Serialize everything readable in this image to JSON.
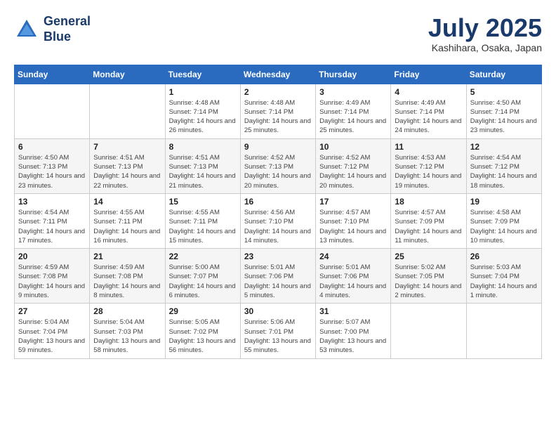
{
  "logo": {
    "line1": "General",
    "line2": "Blue"
  },
  "title": "July 2025",
  "location": "Kashihara, Osaka, Japan",
  "weekdays": [
    "Sunday",
    "Monday",
    "Tuesday",
    "Wednesday",
    "Thursday",
    "Friday",
    "Saturday"
  ],
  "weeks": [
    [
      {
        "day": "",
        "info": ""
      },
      {
        "day": "",
        "info": ""
      },
      {
        "day": "1",
        "info": "Sunrise: 4:48 AM\nSunset: 7:14 PM\nDaylight: 14 hours and 26 minutes."
      },
      {
        "day": "2",
        "info": "Sunrise: 4:48 AM\nSunset: 7:14 PM\nDaylight: 14 hours and 25 minutes."
      },
      {
        "day": "3",
        "info": "Sunrise: 4:49 AM\nSunset: 7:14 PM\nDaylight: 14 hours and 25 minutes."
      },
      {
        "day": "4",
        "info": "Sunrise: 4:49 AM\nSunset: 7:14 PM\nDaylight: 14 hours and 24 minutes."
      },
      {
        "day": "5",
        "info": "Sunrise: 4:50 AM\nSunset: 7:14 PM\nDaylight: 14 hours and 23 minutes."
      }
    ],
    [
      {
        "day": "6",
        "info": "Sunrise: 4:50 AM\nSunset: 7:13 PM\nDaylight: 14 hours and 23 minutes."
      },
      {
        "day": "7",
        "info": "Sunrise: 4:51 AM\nSunset: 7:13 PM\nDaylight: 14 hours and 22 minutes."
      },
      {
        "day": "8",
        "info": "Sunrise: 4:51 AM\nSunset: 7:13 PM\nDaylight: 14 hours and 21 minutes."
      },
      {
        "day": "9",
        "info": "Sunrise: 4:52 AM\nSunset: 7:13 PM\nDaylight: 14 hours and 20 minutes."
      },
      {
        "day": "10",
        "info": "Sunrise: 4:52 AM\nSunset: 7:12 PM\nDaylight: 14 hours and 20 minutes."
      },
      {
        "day": "11",
        "info": "Sunrise: 4:53 AM\nSunset: 7:12 PM\nDaylight: 14 hours and 19 minutes."
      },
      {
        "day": "12",
        "info": "Sunrise: 4:54 AM\nSunset: 7:12 PM\nDaylight: 14 hours and 18 minutes."
      }
    ],
    [
      {
        "day": "13",
        "info": "Sunrise: 4:54 AM\nSunset: 7:11 PM\nDaylight: 14 hours and 17 minutes."
      },
      {
        "day": "14",
        "info": "Sunrise: 4:55 AM\nSunset: 7:11 PM\nDaylight: 14 hours and 16 minutes."
      },
      {
        "day": "15",
        "info": "Sunrise: 4:55 AM\nSunset: 7:11 PM\nDaylight: 14 hours and 15 minutes."
      },
      {
        "day": "16",
        "info": "Sunrise: 4:56 AM\nSunset: 7:10 PM\nDaylight: 14 hours and 14 minutes."
      },
      {
        "day": "17",
        "info": "Sunrise: 4:57 AM\nSunset: 7:10 PM\nDaylight: 14 hours and 13 minutes."
      },
      {
        "day": "18",
        "info": "Sunrise: 4:57 AM\nSunset: 7:09 PM\nDaylight: 14 hours and 11 minutes."
      },
      {
        "day": "19",
        "info": "Sunrise: 4:58 AM\nSunset: 7:09 PM\nDaylight: 14 hours and 10 minutes."
      }
    ],
    [
      {
        "day": "20",
        "info": "Sunrise: 4:59 AM\nSunset: 7:08 PM\nDaylight: 14 hours and 9 minutes."
      },
      {
        "day": "21",
        "info": "Sunrise: 4:59 AM\nSunset: 7:08 PM\nDaylight: 14 hours and 8 minutes."
      },
      {
        "day": "22",
        "info": "Sunrise: 5:00 AM\nSunset: 7:07 PM\nDaylight: 14 hours and 6 minutes."
      },
      {
        "day": "23",
        "info": "Sunrise: 5:01 AM\nSunset: 7:06 PM\nDaylight: 14 hours and 5 minutes."
      },
      {
        "day": "24",
        "info": "Sunrise: 5:01 AM\nSunset: 7:06 PM\nDaylight: 14 hours and 4 minutes."
      },
      {
        "day": "25",
        "info": "Sunrise: 5:02 AM\nSunset: 7:05 PM\nDaylight: 14 hours and 2 minutes."
      },
      {
        "day": "26",
        "info": "Sunrise: 5:03 AM\nSunset: 7:04 PM\nDaylight: 14 hours and 1 minute."
      }
    ],
    [
      {
        "day": "27",
        "info": "Sunrise: 5:04 AM\nSunset: 7:04 PM\nDaylight: 13 hours and 59 minutes."
      },
      {
        "day": "28",
        "info": "Sunrise: 5:04 AM\nSunset: 7:03 PM\nDaylight: 13 hours and 58 minutes."
      },
      {
        "day": "29",
        "info": "Sunrise: 5:05 AM\nSunset: 7:02 PM\nDaylight: 13 hours and 56 minutes."
      },
      {
        "day": "30",
        "info": "Sunrise: 5:06 AM\nSunset: 7:01 PM\nDaylight: 13 hours and 55 minutes."
      },
      {
        "day": "31",
        "info": "Sunrise: 5:07 AM\nSunset: 7:00 PM\nDaylight: 13 hours and 53 minutes."
      },
      {
        "day": "",
        "info": ""
      },
      {
        "day": "",
        "info": ""
      }
    ]
  ]
}
